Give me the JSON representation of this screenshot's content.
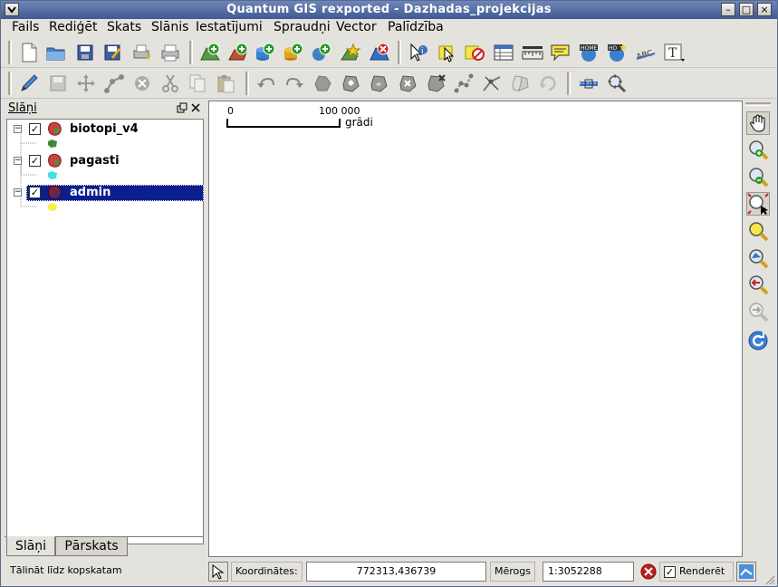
{
  "window": {
    "title": "Quantum GIS rexported - Dazhadas_projekcijas",
    "menu_icon": "chevron-down-icon",
    "minimize": "–",
    "maximize": "□",
    "close": "×"
  },
  "menu": [
    {
      "label": "Fails"
    },
    {
      "label": "Rediģēt"
    },
    {
      "label": "Skats"
    },
    {
      "label": "Slānis"
    },
    {
      "label": "Iestatījumi"
    },
    {
      "label": "Spraudņi"
    },
    {
      "label": "Vector"
    },
    {
      "label": "Palīdzība"
    }
  ],
  "layers_panel": {
    "title": "Slāņi",
    "float_icon": "restore-icon",
    "close_icon": "close-icon",
    "layers": [
      {
        "name": "biotopi_v4",
        "checked": true,
        "symbol_color": "#3d8a3a",
        "expand": "−"
      },
      {
        "name": "pagasti",
        "checked": true,
        "symbol_color": "#40e0e0",
        "expand": "−"
      },
      {
        "name": "admin",
        "checked": true,
        "symbol_color": "#f5f04a",
        "expand": "−",
        "selected": true
      }
    ],
    "check_mark": "✓"
  },
  "tabs": [
    {
      "label": "Slāņi",
      "active": true
    },
    {
      "label": "Pārskats",
      "active": false
    }
  ],
  "map": {
    "scale_left": "0",
    "scale_right": "100 000",
    "scale_unit": "grādi"
  },
  "status": {
    "message": "Tālināt līdz kopskatam",
    "coord_label": "Koordinātes:",
    "coord_value": "772313,436739",
    "scale_label": "Mērogs",
    "scale_value": "1:3052288",
    "render_label": "Renderēt",
    "render_checked": true
  },
  "colors": {
    "titlebar": "#4f6aa3",
    "selection": "#0a1e8c",
    "canvas": "#ffffff"
  }
}
